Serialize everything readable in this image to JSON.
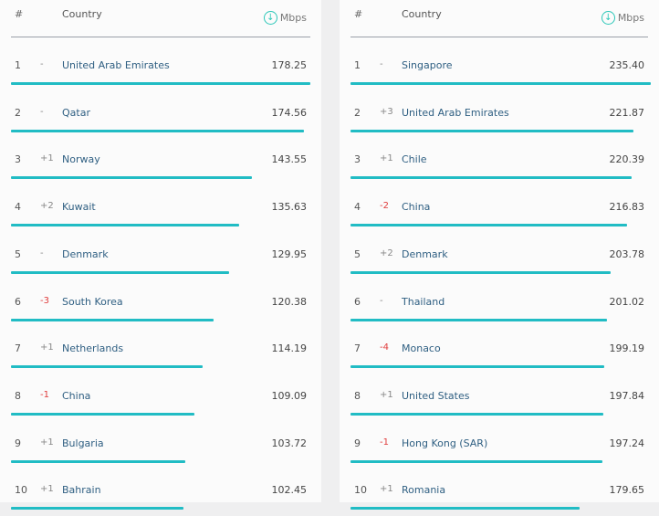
{
  "header": {
    "rank": "#",
    "country": "Country",
    "unit": "Mbps",
    "sort_icon": "download-arrow-circle-icon"
  },
  "accent": "#21bcc4",
  "tables": [
    {
      "rows": [
        {
          "rank": "1",
          "change": "-",
          "country": "United Arab Emirates",
          "speed": "178.25"
        },
        {
          "rank": "2",
          "change": "-",
          "country": "Qatar",
          "speed": "174.56"
        },
        {
          "rank": "3",
          "change": "+1",
          "country": "Norway",
          "speed": "143.55"
        },
        {
          "rank": "4",
          "change": "+2",
          "country": "Kuwait",
          "speed": "135.63"
        },
        {
          "rank": "5",
          "change": "-",
          "country": "Denmark",
          "speed": "129.95"
        },
        {
          "rank": "6",
          "change": "-3",
          "country": "South Korea",
          "speed": "120.38"
        },
        {
          "rank": "7",
          "change": "+1",
          "country": "Netherlands",
          "speed": "114.19"
        },
        {
          "rank": "8",
          "change": "-1",
          "country": "China",
          "speed": "109.09"
        },
        {
          "rank": "9",
          "change": "+1",
          "country": "Bulgaria",
          "speed": "103.72"
        },
        {
          "rank": "10",
          "change": "+1",
          "country": "Bahrain",
          "speed": "102.45"
        }
      ]
    },
    {
      "rows": [
        {
          "rank": "1",
          "change": "-",
          "country": "Singapore",
          "speed": "235.40"
        },
        {
          "rank": "2",
          "change": "+3",
          "country": "United Arab Emirates",
          "speed": "221.87"
        },
        {
          "rank": "3",
          "change": "+1",
          "country": "Chile",
          "speed": "220.39"
        },
        {
          "rank": "4",
          "change": "-2",
          "country": "China",
          "speed": "216.83"
        },
        {
          "rank": "5",
          "change": "+2",
          "country": "Denmark",
          "speed": "203.78"
        },
        {
          "rank": "6",
          "change": "-",
          "country": "Thailand",
          "speed": "201.02"
        },
        {
          "rank": "7",
          "change": "-4",
          "country": "Monaco",
          "speed": "199.19"
        },
        {
          "rank": "8",
          "change": "+1",
          "country": "United States",
          "speed": "197.84"
        },
        {
          "rank": "9",
          "change": "-1",
          "country": "Hong Kong (SAR)",
          "speed": "197.24"
        },
        {
          "rank": "10",
          "change": "+1",
          "country": "Romania",
          "speed": "179.65"
        }
      ]
    }
  ]
}
